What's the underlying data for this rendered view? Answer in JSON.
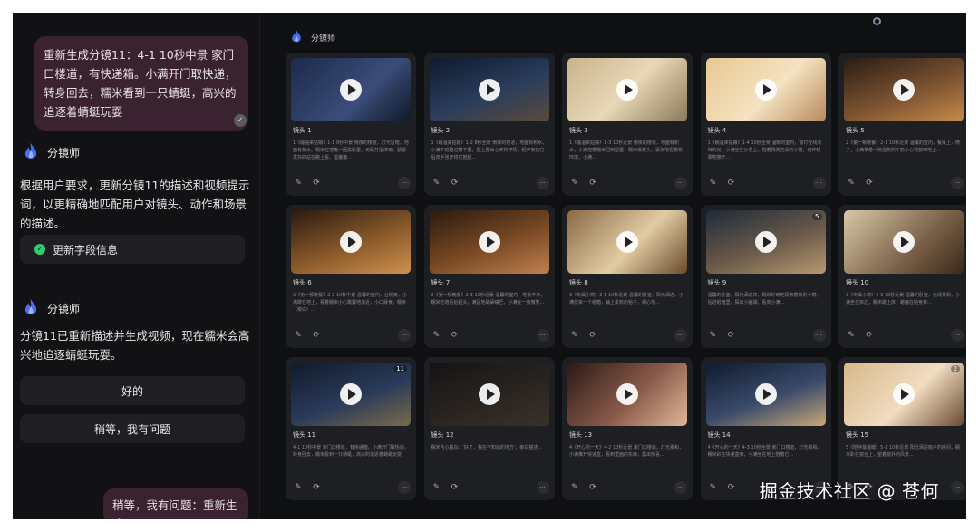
{
  "chat": {
    "user_message_1": "重新生成分镜11：4-1 10秒中景 家门口楼道，有快递箱。小满开门取快递，转身回去，糯米看到一只蜻蜓，高兴的追逐着蜻蜓玩耍",
    "agent_name": "分镜师",
    "agent_text_1": "根据用户要求，更新分镜11的描述和视频提示词，以更精确地匹配用户对镜头、动作和场景的描述。",
    "info_pill": "更新字段信息",
    "agent_text_2": "分镜11已重新描述并生成视频，现在糯米会高兴地追逐蜻蜓玩耍。",
    "reply_ok": "好的",
    "reply_question": "稍等，我有问题",
    "user_message_2": "稍等，我有问题：重新生成"
  },
  "main": {
    "header_name": "分镜师",
    "accent": "#5a7cff"
  },
  "shots": [
    {
      "title": "镜头 1",
      "desc": "1《睡温柔姑娘》1-1 8秒中景 雨夜的楼道，灯光昏暗，地面有积水。糯米在墙角一团黑影里，无助打湿淋雨，瑟瑟发抖的站在路上看，湿漉漉...",
      "badge": ""
    },
    {
      "title": "镜头 2",
      "desc": "1《睡温柔姑娘》1-2 8秒全景 雨夜的楼道，地面有积水，小满下班路过楼下里，脸上露出心疼的神情，轻声安抚它后双手张开将它抱起...",
      "badge": ""
    },
    {
      "title": "镜头 3",
      "desc": "1《睡温柔姑娘》1-3 10秒近景 雨夜的楼道，地面有积水，小满抱着糯米回到屋里，糯米低着头，紧张地看着新环境，小满...",
      "badge": ""
    },
    {
      "title": "镜头 4",
      "desc": "1《糯温柔姑娘》1-4 10秒全景 温暖的室内，窗灯光线柔和的光，小满坐在沙发上，抱着刚洗完澡的小猫，动作轻柔地擦干...",
      "badge": ""
    },
    {
      "title": "镜头 5",
      "desc": "2《第一顿晚餐》2-1 10秒近景 温馨的室内，餐桌上，椅子，小满拿着一碗温热的牛奶小心地放到地上...",
      "badge": ""
    },
    {
      "title": "镜头 6",
      "desc": "2《第一顿晚餐》2-2 10秒中景 温馨的室内，台阶旁，小满蹲在地上，看着糯米小心翼翼地凑近，小口舔食，糯米（旁白）...",
      "badge": ""
    },
    {
      "title": "镜头 7",
      "desc": "2《第一顿晚餐》2-3 10秒近景 温馨的室内，地板干净，糯米吃饱后抬起头，满足地舔舔嘴巴，小满在一旁微笑...",
      "badge": ""
    },
    {
      "title": "镜头 8",
      "desc": "3《专属小窝》3-1 10秒近景 温馨的卧室，阳光洒进，小满找来一个纸箱，铺上柔软的毯子，细心地...",
      "badge": ""
    },
    {
      "title": "镜头 9",
      "desc": "温馨的卧室，阳光洒进来，糯米好奇地探索着新的小窝，钻进纸箱里，探出小脑袋，看向小满...",
      "badge": "5"
    },
    {
      "title": "镜头 10",
      "desc": "3《专属小窝》3-3 10秒近景 温馨的卧室，光线柔和，小满坐在床边，糯米跳上床，蜷缩在她身旁...",
      "badge": ""
    },
    {
      "title": "镜头 11",
      "desc": "4-1 10秒中景 家门口楼道，有快递箱。小满开门取快递，转身回去，糯米看到一只蜻蜓，高兴的追逐着蜻蜓玩耍",
      "badge": "11"
    },
    {
      "title": "镜头 12",
      "desc": "糯米内心独白：'好了，我在不知道的地方'，旁白描述...",
      "badge": ""
    },
    {
      "title": "镜头 13",
      "desc": "4《开心的一天》4-2 10秒近景 家门口楼道，灯光柔和，小满推开快递盒，看到里面的东西，露出惊喜...",
      "badge": ""
    },
    {
      "title": "镜头 14",
      "desc": "4《开心的一天》4-3 10秒全景 家门口楼道，灯光柔和，糯米趴在快递盒旁，小满坐在地上陪着它...",
      "badge": ""
    },
    {
      "title": "镜头 15",
      "desc": "5《陪伴最温暖》5-1 10秒近景 阳光洒进窗户的房间，糯米趴在窗台上，望着窗外的风景...",
      "badge": "2"
    }
  ],
  "tools": {
    "edit_icon": "✎",
    "regen_icon": "⟳",
    "more_icon": "···"
  },
  "watermark": "掘金技术社区 @ 苍何"
}
